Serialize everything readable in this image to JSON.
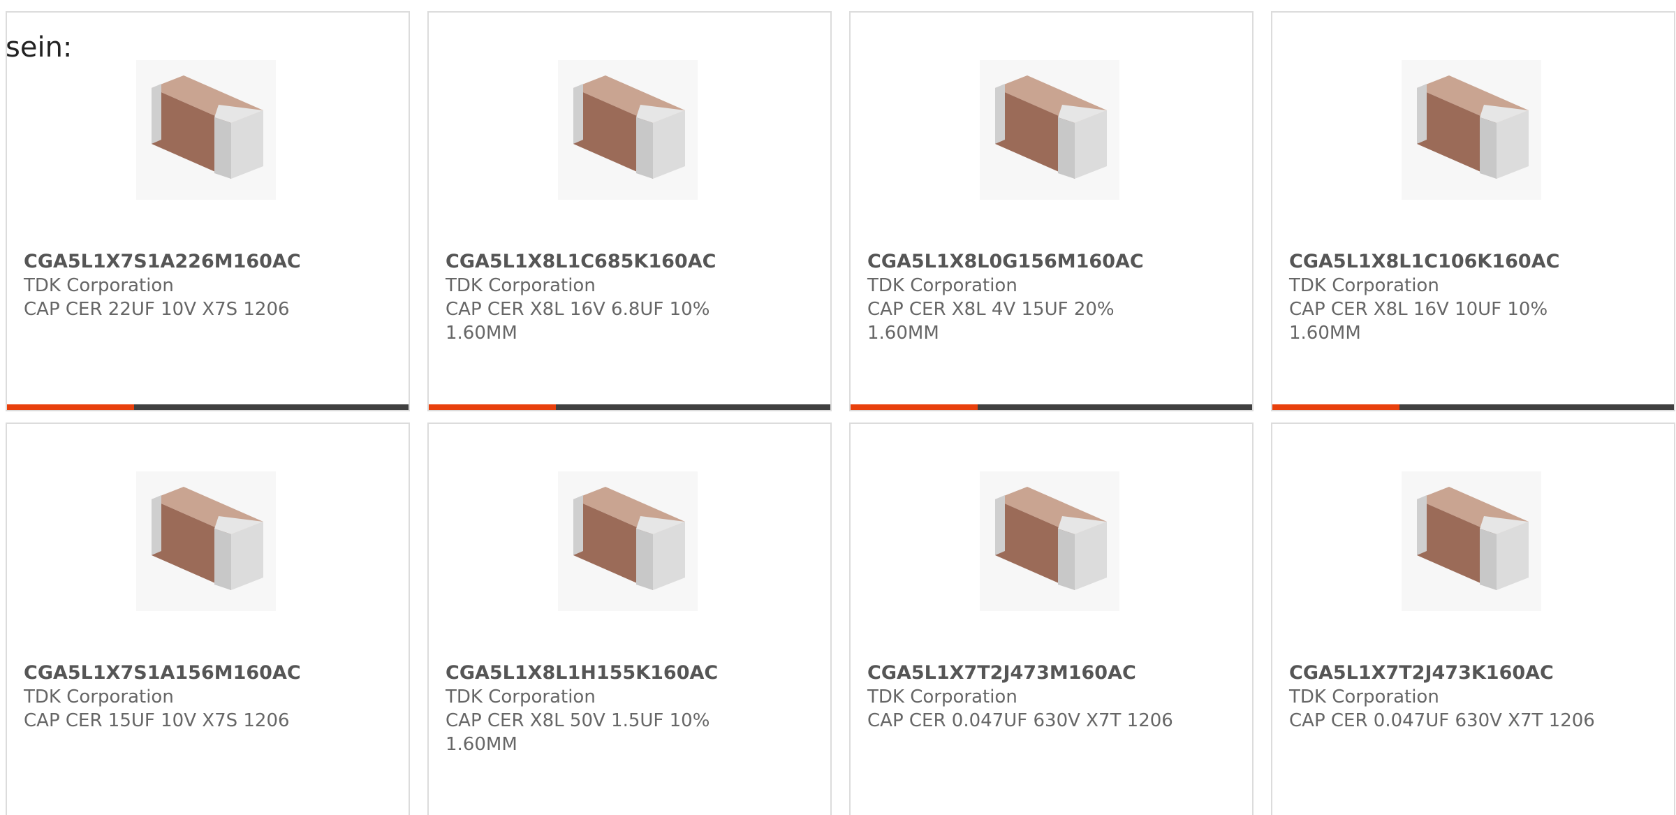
{
  "page": {
    "heading_fragment": "sein:"
  },
  "colors": {
    "accent": "#e8400c",
    "bar_track": "#404040",
    "card_border": "#dcdcdc",
    "text": "#666666"
  },
  "products": [
    {
      "part_number": "CGA5L1X7S1A226M160AC",
      "manufacturer": "TDK Corporation",
      "description": "CAP CER 22UF 10V X7S 1206",
      "image_icon": "ceramic-capacitor-chip-image",
      "show_bar": true
    },
    {
      "part_number": "CGA5L1X8L1C685K160AC",
      "manufacturer": "TDK Corporation",
      "description": "CAP CER X8L 16V 6.8UF 10% 1.60MM",
      "image_icon": "ceramic-capacitor-chip-image",
      "show_bar": true
    },
    {
      "part_number": "CGA5L1X8L0G156M160AC",
      "manufacturer": "TDK Corporation",
      "description": "CAP CER X8L 4V 15UF 20% 1.60MM",
      "image_icon": "ceramic-capacitor-chip-image",
      "show_bar": true
    },
    {
      "part_number": "CGA5L1X8L1C106K160AC",
      "manufacturer": "TDK Corporation",
      "description": "CAP CER X8L 16V 10UF 10% 1.60MM",
      "image_icon": "ceramic-capacitor-chip-image",
      "show_bar": true
    },
    {
      "part_number": "CGA5L1X7S1A156M160AC",
      "manufacturer": "TDK Corporation",
      "description": "CAP CER 15UF 10V X7S 1206",
      "image_icon": "ceramic-capacitor-chip-image",
      "show_bar": false
    },
    {
      "part_number": "CGA5L1X8L1H155K160AC",
      "manufacturer": "TDK Corporation",
      "description": "CAP CER X8L 50V 1.5UF 10% 1.60MM",
      "image_icon": "ceramic-capacitor-chip-image",
      "show_bar": false
    },
    {
      "part_number": "CGA5L1X7T2J473M160AC",
      "manufacturer": "TDK Corporation",
      "description": "CAP CER 0.047UF 630V X7T 1206",
      "image_icon": "ceramic-capacitor-chip-image",
      "show_bar": false
    },
    {
      "part_number": "CGA5L1X7T2J473K160AC",
      "manufacturer": "TDK Corporation",
      "description": "CAP CER 0.047UF 630V X7T 1206",
      "image_icon": "ceramic-capacitor-chip-image",
      "show_bar": false
    }
  ]
}
